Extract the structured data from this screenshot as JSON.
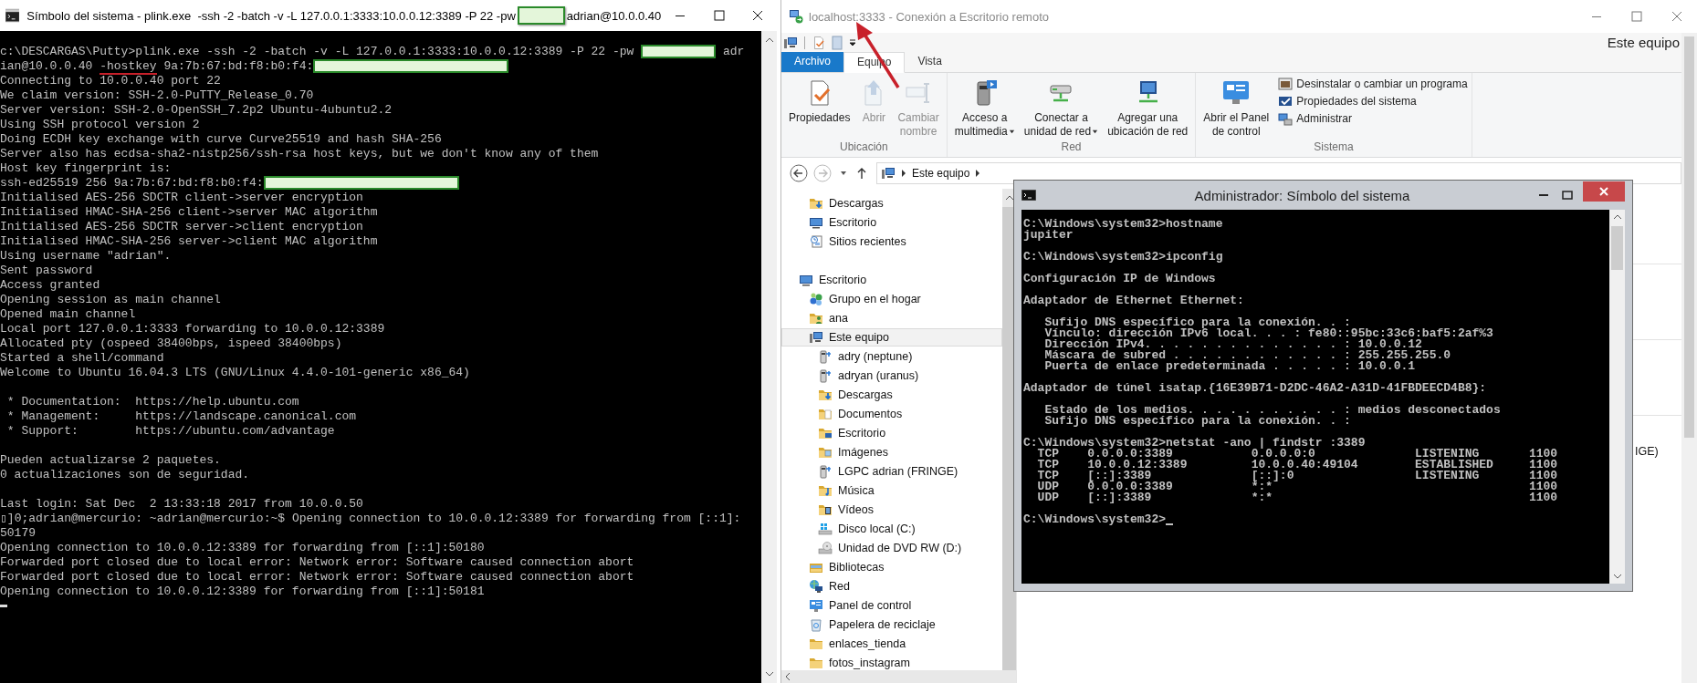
{
  "left_window": {
    "title_parts": [
      {
        "kind": "text",
        "text": "Símbolo del sistema - plink.exe  -ssh -2 -batch -v -L 127.0.0.1:3333:10.0.0.12:3389 -P 22 -pw"
      },
      {
        "kind": "redacted"
      },
      {
        "kind": "text",
        "text": "adrian@10.0.0.40"
      }
    ],
    "terminal_blocks": [
      [
        [
          {
            "kind": "text",
            "text": "c:\\DESCARGAS\\Putty>plink.exe -ssh -2 -batch -v -L 127.0.0.1:3333:10.0.0.12:3389 -P 22 -pw "
          },
          {
            "kind": "redacted"
          },
          {
            "kind": "text",
            "text": " adr"
          }
        ],
        [
          {
            "kind": "text",
            "text": "ian@10.0.0.40 "
          },
          {
            "kind": "marked",
            "text": "-hostkey"
          },
          {
            "kind": "text",
            "text": " 9a:7b:67:bd:f8:b0:f4:"
          },
          {
            "kind": "redacted"
          }
        ],
        "Connecting to 10.0.0.40 port 22",
        "We claim version: SSH-2.0-PuTTY_Release_0.70",
        "Server version: SSH-2.0-OpenSSH_7.2p2 Ubuntu-4ubuntu2.2",
        "Using SSH protocol version 2",
        "Doing ECDH key exchange with curve Curve25519 and hash SHA-256",
        "Server also has ecdsa-sha2-nistp256/ssh-rsa host keys, but we don't know any of them",
        "Host key fingerprint is:",
        [
          {
            "kind": "text",
            "text": "ssh-ed25519 256 9a:7b:67:bd:f8:b0:f4:"
          },
          {
            "kind": "redacted"
          }
        ],
        "Initialised AES-256 SDCTR client->server encryption",
        "Initialised HMAC-SHA-256 client->server MAC algorithm",
        "Initialised AES-256 SDCTR server->client encryption",
        "Initialised HMAC-SHA-256 server->client MAC algorithm",
        "Using username \"adrian\".",
        "Sent password",
        "Access granted",
        "Opening session as main channel",
        "Opened main channel",
        "Local port 127.0.0.1:3333 forwarding to 10.0.0.12:3389",
        "Allocated pty (ospeed 38400bps, ispeed 38400bps)",
        "Started a shell/command",
        "Welcome to Ubuntu 16.04.3 LTS (GNU/Linux 4.4.0-101-generic x86_64)"
      ],
      [
        " * Documentation:  https://help.ubuntu.com",
        " * Management:     https://landscape.canonical.com",
        " * Support:        https://ubuntu.com/advantage"
      ],
      [
        "Pueden actualizarse 2 paquetes.",
        "0 actualizaciones son de seguridad."
      ],
      [
        "Last login: Sat Dec  2 13:33:18 2017 from 10.0.0.50",
        "▯]0;adrian@mercurio: ~adrian@mercurio:~$ Opening connection to 10.0.0.12:3389 for forwarding from [::1]:",
        "50179",
        "Opening connection to 10.0.0.12:3389 for forwarding from [::1]:50180",
        "Forwarded port closed due to local error: Network error: Software caused connection abort",
        "Forwarded port closed due to local error: Network error: Software caused connection abort",
        "Opening connection to 10.0.0.12:3389 for forwarding from [::1]:50181"
      ]
    ]
  },
  "right_window": {
    "title": "localhost:3333 - Conexión a Escritorio remoto",
    "qat_location": "Este equipo",
    "ribbon_tabs": [
      {
        "label": "Archivo",
        "kind": "file",
        "selected": false
      },
      {
        "label": "Equipo",
        "kind": "tab",
        "selected": true
      },
      {
        "label": "Vista",
        "kind": "tab",
        "selected": false
      }
    ],
    "ribbon_groups": [
      {
        "label": "Ubicación",
        "buttons": [
          {
            "label": "Propiedades",
            "disabled": false,
            "dropdown": false
          },
          {
            "label": "Abrir",
            "disabled": true,
            "dropdown": false
          },
          {
            "label": "Cambiar\nnombre",
            "disabled": true,
            "dropdown": false
          }
        ]
      },
      {
        "label": "Red",
        "buttons": [
          {
            "label": "Acceso a\nmultimedia",
            "disabled": false,
            "dropdown": true
          },
          {
            "label": "Conectar a\nunidad de red",
            "disabled": false,
            "dropdown": true
          },
          {
            "label": "Agregar una\nubicación de red",
            "disabled": false,
            "dropdown": false
          }
        ]
      },
      {
        "label": "Sistema",
        "buttons": [
          {
            "label": "Abrir el Panel\nde control",
            "disabled": false,
            "dropdown": false
          }
        ],
        "small_buttons": [
          {
            "label": "Desinstalar o cambiar un programa"
          },
          {
            "label": "Propiedades del sistema"
          },
          {
            "label": "Administrar"
          }
        ]
      }
    ],
    "address": {
      "path": "Este equipo"
    },
    "nav_pane": {
      "quick_access": [
        {
          "label": "Descargas"
        },
        {
          "label": "Escritorio"
        },
        {
          "label": "Sitios recientes"
        }
      ],
      "tree": [
        {
          "label": "Escritorio",
          "selected": false,
          "children": [
            {
              "label": "Grupo en el hogar",
              "selected": false
            },
            {
              "label": "ana",
              "selected": false
            },
            {
              "label": "Este equipo",
              "selected": true,
              "children": [
                {
                  "label": "adry (neptune)",
                  "selected": false
                },
                {
                  "label": "adryan (uranus)",
                  "selected": false
                },
                {
                  "label": "Descargas",
                  "selected": false
                },
                {
                  "label": "Documentos",
                  "selected": false
                },
                {
                  "label": "Escritorio",
                  "selected": false
                },
                {
                  "label": "Imágenes",
                  "selected": false
                },
                {
                  "label": "LGPC adrian (FRINGE)",
                  "selected": false
                },
                {
                  "label": "Música",
                  "selected": false
                },
                {
                  "label": "Vídeos",
                  "selected": false
                },
                {
                  "label": "Disco local (C:)",
                  "selected": false
                },
                {
                  "label": "Unidad de DVD RW (D:)",
                  "selected": false
                }
              ]
            },
            {
              "label": "Bibliotecas",
              "selected": false
            },
            {
              "label": "Red",
              "selected": false
            },
            {
              "label": "Panel de control",
              "selected": false
            },
            {
              "label": "Papelera de reciclaje",
              "selected": false
            },
            {
              "label": "enlaces_tienda",
              "selected": false
            },
            {
              "label": "fotos_instagram",
              "selected": false
            }
          ]
        }
      ]
    },
    "content_pane": {
      "partial_text": "IGE)"
    },
    "cmd_window": {
      "title": "Administrador: Símbolo del sistema",
      "blocks": [
        [
          "C:\\Windows\\system32>hostname",
          "jupiter"
        ],
        [
          "C:\\Windows\\system32>ipconfig"
        ],
        [
          "Configuración IP de Windows"
        ],
        [
          "Adaptador de Ethernet Ethernet:"
        ],
        [
          "   Sufijo DNS específico para la conexión. . :",
          "   Vínculo: dirección IPv6 local. . . : fe80::95bc:33c6:baf5:2af%3",
          "   Dirección IPv4. . . . . . . . . . . . . . : 10.0.0.12",
          "   Máscara de subred . . . . . . . . . . . . : 255.255.255.0",
          "   Puerta de enlace predeterminada . . . . . : 10.0.0.1"
        ],
        [
          "Adaptador de túnel isatap.{16E39B71-D2DC-46A2-A31D-41FBDEECD4B8}:"
        ],
        [
          "   Estado de los medios. . . . . . . . . . . : medios desconectados",
          "   Sufijo DNS específico para la conexión. . :"
        ],
        [
          "C:\\Windows\\system32>netstat -ano | findstr :3389",
          "  TCP    0.0.0.0:3389           0.0.0.0:0              LISTENING       1100",
          "  TCP    10.0.0.12:3389         10.0.0.40:49104        ESTABLISHED     1100",
          "  TCP    [::]:3389              [::]:0                 LISTENING       1100",
          "  UDP    0.0.0.0:3389           *:*                                    1100",
          "  UDP    [::]:3389              *:*                                    1100"
        ],
        [
          "C:\\Windows\\system32>"
        ]
      ]
    }
  }
}
